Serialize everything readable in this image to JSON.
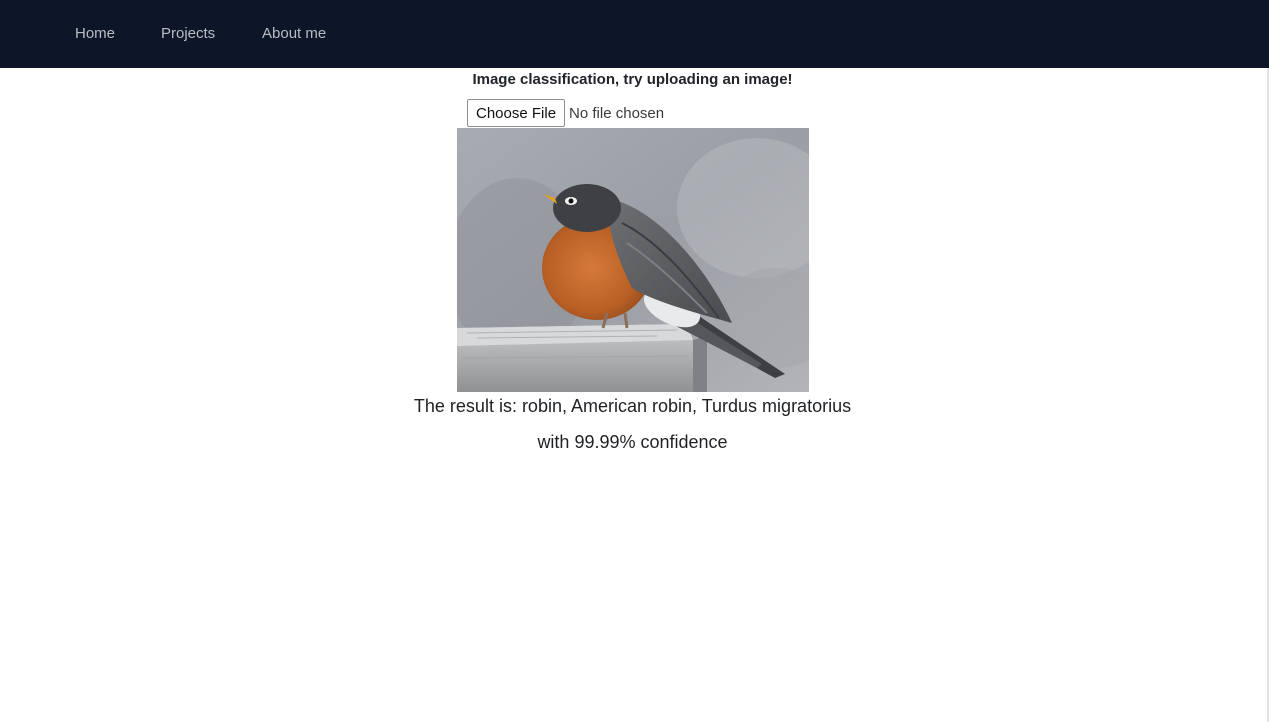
{
  "nav": {
    "items": [
      {
        "label": "Home"
      },
      {
        "label": "Projects"
      },
      {
        "label": "About me"
      }
    ],
    "background_color": "#0d1628"
  },
  "main": {
    "heading": "Image classification, try uploading an image!",
    "file_input": {
      "button_label": "Choose File",
      "status_text": "No file chosen"
    },
    "image": {
      "icon": "robin-photo"
    },
    "result_line": "The result is: robin, American robin, Turdus migratorius",
    "confidence_line": "with 99.99% confidence"
  }
}
